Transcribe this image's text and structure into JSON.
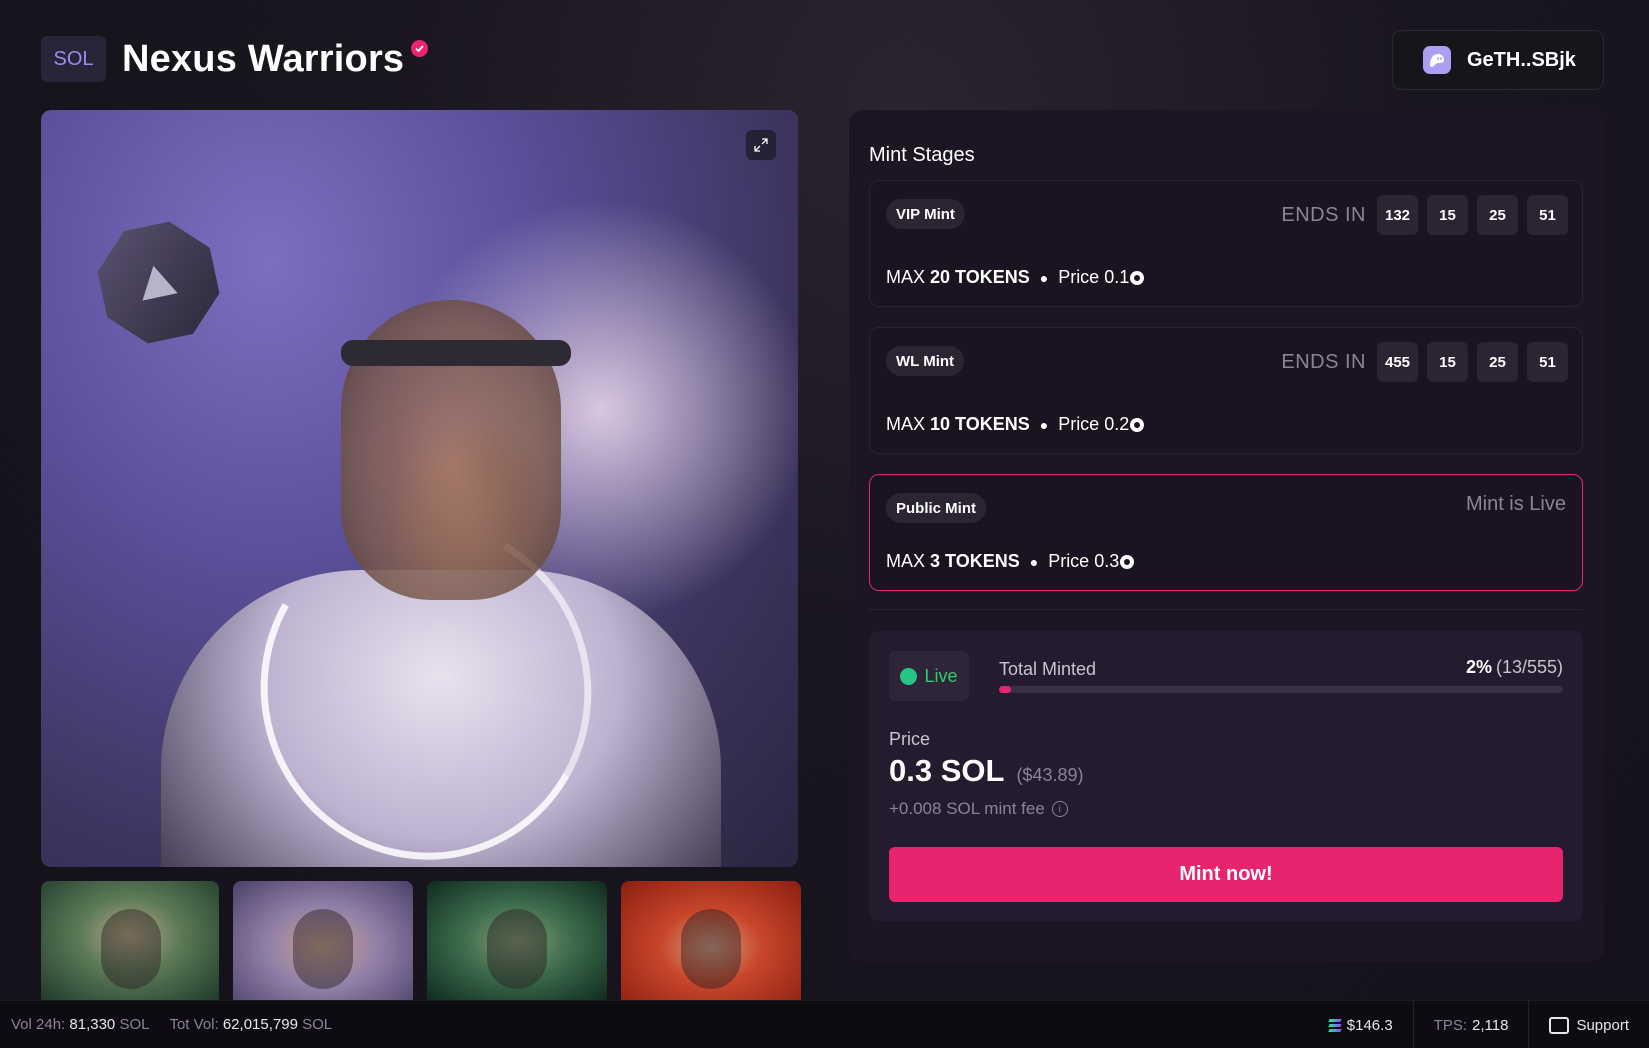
{
  "header": {
    "chain_badge": "SOL",
    "title": "Nexus Warriors",
    "wallet": "GeTH..SBjk"
  },
  "icons": {
    "verified": "verified-check-icon",
    "wallet": "phantom-ghost-icon",
    "expand": "expand-icon",
    "info": "info-icon",
    "support": "chat-bubble-icon",
    "sol": "solana-logo-icon"
  },
  "colors": {
    "accent": "#e8246f",
    "live": "#26c485",
    "panel_bg": "#1c1624"
  },
  "mint": {
    "section_title": "Mint Stages",
    "stages": [
      {
        "name": "VIP Mint",
        "status_label": "ENDS IN",
        "countdown": [
          "132",
          "15",
          "25",
          "51"
        ],
        "max_prefix": "MAX",
        "max_tokens": "20 TOKENS",
        "price_label": "Price 0.1"
      },
      {
        "name": "WL Mint",
        "status_label": "ENDS IN",
        "countdown": [
          "455",
          "15",
          "25",
          "51"
        ],
        "max_prefix": "MAX",
        "max_tokens": "10 TOKENS",
        "price_label": "Price 0.2"
      },
      {
        "name": "Public Mint",
        "status_label": "Mint is Live",
        "max_prefix": "MAX",
        "max_tokens": "3 TOKENS",
        "price_label": "Price 0.3"
      }
    ],
    "live_label": "Live",
    "total_minted_label": "Total Minted",
    "total_percent": "2%",
    "total_count": "(13/555)",
    "progress_fraction": 0.02,
    "price_label": "Price",
    "price": "0.3 SOL",
    "price_usd": "($43.89)",
    "fee": "+0.008 SOL mint fee",
    "mint_button": "Mint now!"
  },
  "footer": {
    "vol_label": "Vol 24h:",
    "vol_value": "81,330",
    "vol_unit": "SOL",
    "tot_label": "Tot Vol:",
    "tot_value": "62,015,799",
    "tot_unit": "SOL",
    "sol_price": "$146.3",
    "tps_label": "TPS:",
    "tps_value": "2,118",
    "support": "Support"
  }
}
